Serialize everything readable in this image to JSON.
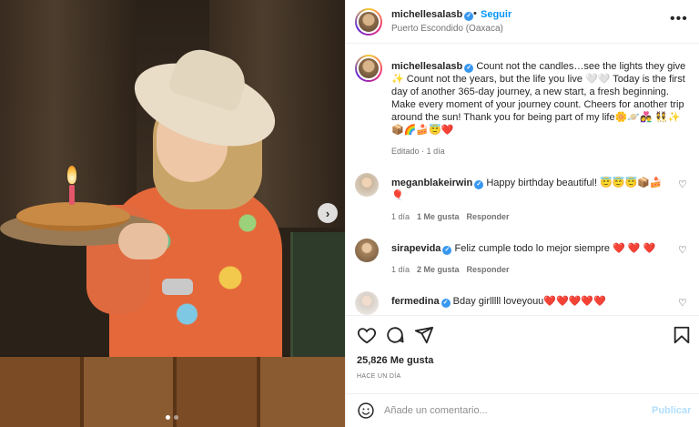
{
  "post": {
    "author": "michellesalasb",
    "follow_label": "Seguir",
    "separator": "•",
    "location": "Puerto Escondido (Oaxaca)",
    "more_icon": "more-options-icon",
    "more_glyph": "•••"
  },
  "caption": {
    "username": "michellesalasb",
    "text": "Count not the candles…see the lights they give ✨ Count not the years, but the life you live 🤍🤍 Today is the first day of another 365-day journey, a new start, a fresh beginning. Make every moment of your journey count. Cheers for another trip around the sun! Thank you for being part of my life🌼🪐👩‍❤️‍👨 👯✨📦🌈🍰😇❤️",
    "edited": "Editado",
    "separator": "·",
    "age": "1 día"
  },
  "comments": [
    {
      "username": "meganblakeirwin",
      "text": "Happy birthday beautiful! 😇😇😇📦🍰🎈",
      "age": "1 día",
      "likes": "1 Me gusta",
      "reply": "Responder"
    },
    {
      "username": "sirapevida",
      "text": "Feliz cumple todo lo mejor siempre ",
      "hearts": "❤️ ❤️ ❤️",
      "age": "1 día",
      "likes": "2 Me gusta",
      "reply": "Responder"
    },
    {
      "username": "fermedina",
      "text": "Bday girlllll loveyouu",
      "hearts": "❤️❤️❤️❤️❤️"
    }
  ],
  "actions": {
    "like_icon": "heart-icon",
    "comment_icon": "comment-icon",
    "share_icon": "share-icon",
    "save_icon": "bookmark-icon",
    "likes_count": "25,826 Me gusta",
    "timestamp": "HACE UN DÍA"
  },
  "composer": {
    "placeholder": "Añade un comentario...",
    "post_label": "Publicar",
    "emoji_icon": "emoji-icon"
  },
  "media": {
    "next_glyph": "›",
    "carousel_index": 1,
    "carousel_total": 2
  },
  "colors": {
    "accent": "#0095f6",
    "text": "#262626",
    "muted": "#737373",
    "verified": "#3897f0"
  }
}
